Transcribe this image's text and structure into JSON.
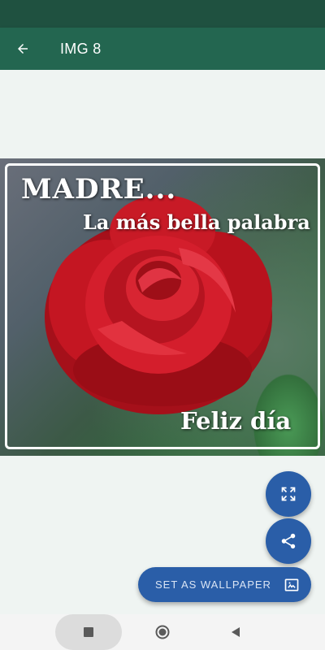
{
  "app_bar": {
    "title": "IMG 8",
    "back_icon": "arrow-back-icon"
  },
  "image": {
    "line1": "MADRE...",
    "line2": "La más bella palabra",
    "line3": "Feliz día"
  },
  "actions": {
    "expand_icon": "fullscreen-icon",
    "share_icon": "share-icon",
    "wallpaper_label": "SET AS WALLPAPER",
    "wallpaper_icon": "wallpaper-icon"
  },
  "colors": {
    "status_bar": "#1f5140",
    "app_bar": "#236650",
    "accent": "#2a5ea8",
    "background": "#eff4f2"
  },
  "nav": {
    "recents_icon": "square-recents-icon",
    "home_icon": "circle-home-icon",
    "back_icon": "triangle-back-icon"
  }
}
